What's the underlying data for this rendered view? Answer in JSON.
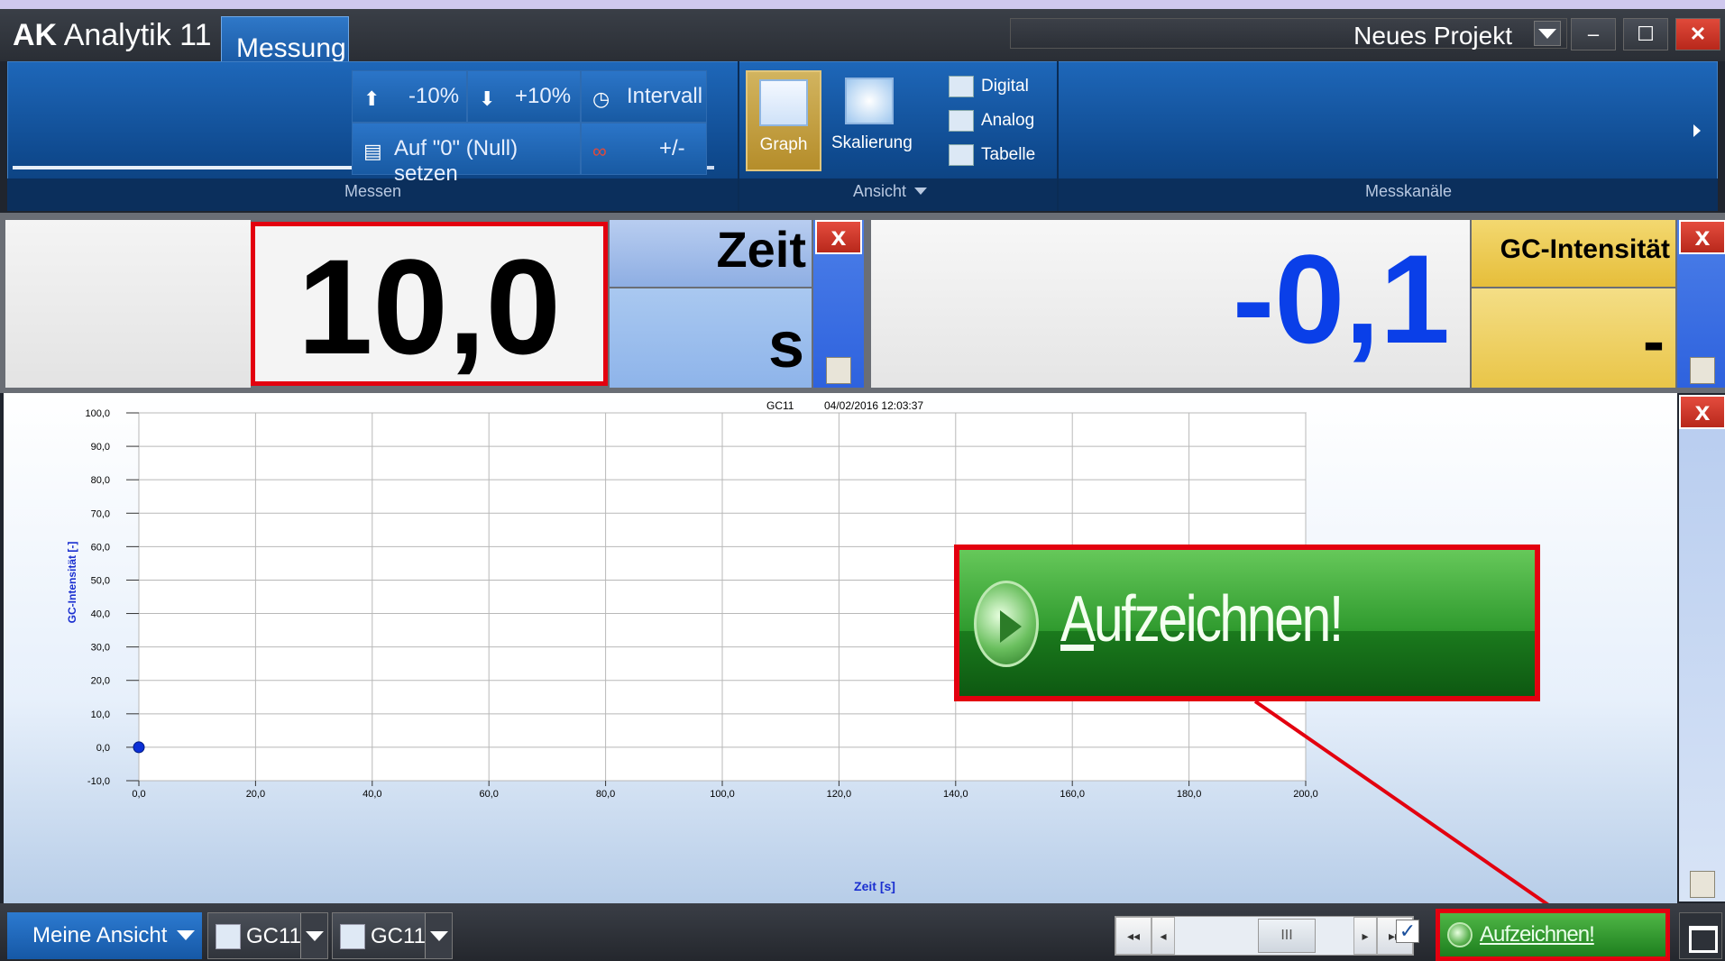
{
  "app": {
    "title_bold": "AK",
    "title_rest": "Analytik 11",
    "active_tab": "Messung",
    "project": "Neues Projekt",
    "window_min": "–",
    "window_max": "☐",
    "window_close": "✕"
  },
  "ribbon": {
    "messen": {
      "label": "Messen",
      "btn_minus": "-10%",
      "btn_plus": "+10%",
      "btn_intervall": "Intervall",
      "btn_null": "Auf \"0\" (Null) setzen",
      "btn_plusminus": "+/-"
    },
    "ansicht": {
      "label": "Ansicht",
      "graph": "Graph",
      "skalierung": "Skalierung",
      "digital": "Digital",
      "analog": "Analog",
      "tabelle": "Tabelle"
    },
    "messkanaele": {
      "label": "Messkanäle"
    }
  },
  "displays": {
    "left": {
      "value": "10,0",
      "name": "Zeit",
      "unit": "s"
    },
    "right": {
      "value": "-0,1",
      "name": "GC-Intensität",
      "unit": "-"
    },
    "close_glyph": "x"
  },
  "chart_data": {
    "type": "scatter",
    "title": "GC11",
    "timestamp": "04/02/2016 12:03:37",
    "xlabel": "Zeit [s]",
    "ylabel": "GC-Intensität [-]",
    "xlim": [
      0,
      200
    ],
    "ylim": [
      -10,
      100
    ],
    "x_ticks": [
      "0,0",
      "20,0",
      "40,0",
      "60,0",
      "80,0",
      "100,0",
      "120,0",
      "140,0",
      "160,0",
      "180,0",
      "200,0"
    ],
    "y_ticks": [
      "100,0",
      "90,0",
      "80,0",
      "70,0",
      "60,0",
      "50,0",
      "40,0",
      "30,0",
      "20,0",
      "10,0",
      "0,0",
      "-10,0"
    ],
    "grid": true,
    "series": [
      {
        "x": [
          0
        ],
        "y": [
          0
        ]
      }
    ],
    "colors": {
      "point": "#0b2fd6"
    }
  },
  "callout": {
    "text": "Aufzeichnen!",
    "underline_char": "A",
    "rest": "ufzeichnen!"
  },
  "statusbar": {
    "view": "Meine Ansicht",
    "tab1": "GC11",
    "tab2": "GC11",
    "nav_first": "◂◂",
    "nav_prev": "◂",
    "nav_thumb": "III",
    "nav_next": "▸",
    "nav_last": "▸▸",
    "checkbox": "✓",
    "record": "Aufzeichnen!"
  }
}
